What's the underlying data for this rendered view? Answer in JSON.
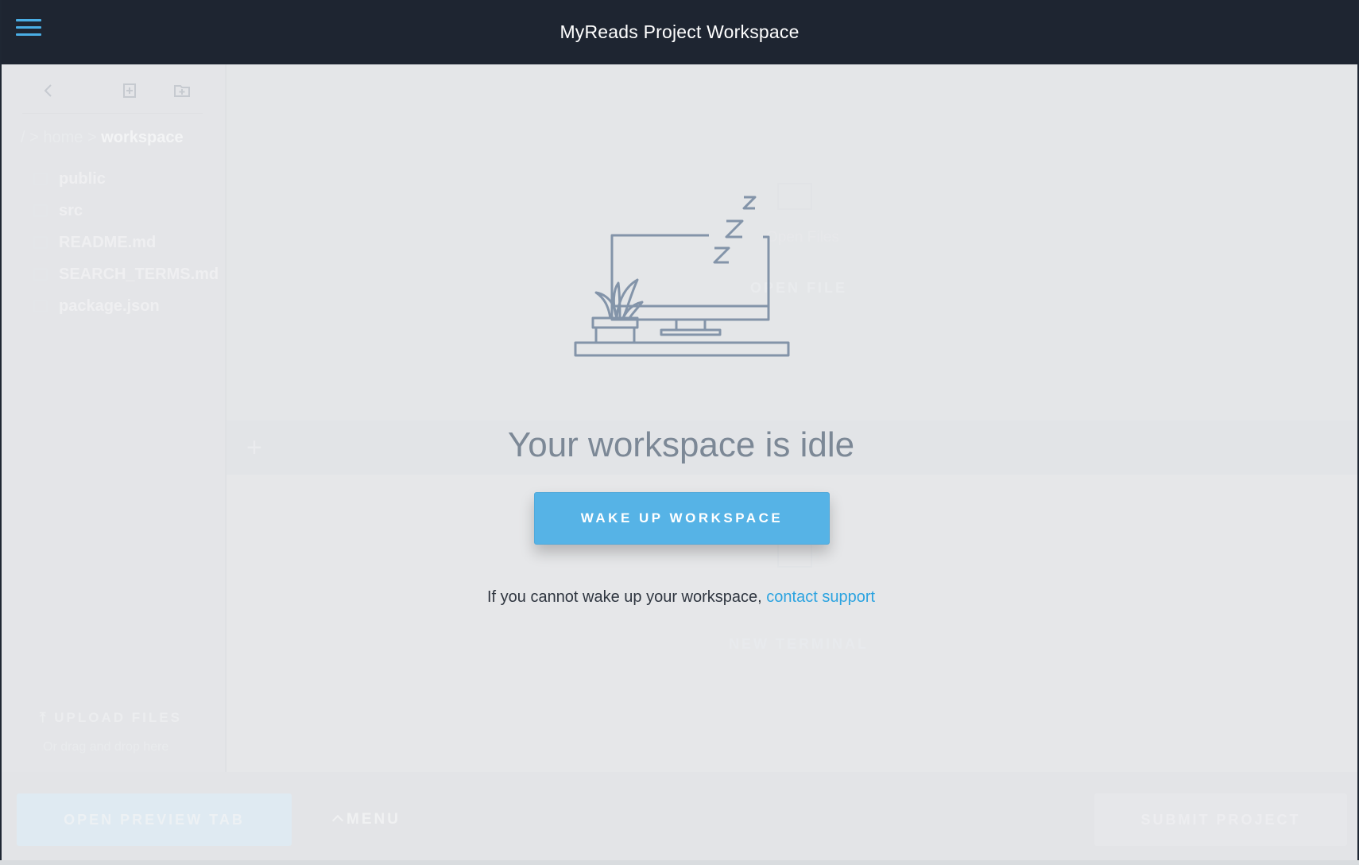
{
  "header": {
    "title": "MyReads Project Workspace",
    "menu_icon": "hamburger-icon"
  },
  "sidebar": {
    "tools": {
      "back_icon": "chevron-left-icon",
      "new_file_icon": "new-file-icon",
      "new_folder_icon": "new-folder-icon"
    },
    "breadcrumb": {
      "root": "/ > ",
      "parent": "home > ",
      "current": "workspace"
    },
    "files": [
      {
        "name": "public",
        "type": "folder"
      },
      {
        "name": "src",
        "type": "folder"
      },
      {
        "name": "README.md",
        "type": "file"
      },
      {
        "name": "SEARCH_TERMS.md",
        "type": "file"
      },
      {
        "name": "package.json",
        "type": "file"
      }
    ],
    "upload_label": "UPLOAD FILES",
    "drag_hint": "Or drag and drop here"
  },
  "editor": {
    "open_files_label": "Open Files",
    "open_file_button": "OPEN FILE"
  },
  "terminal": {
    "add_icon": "plus-icon",
    "new_terminal_button": "NEW TERMINAL"
  },
  "footer": {
    "preview_button": "OPEN PREVIEW TAB",
    "menu_button": "MENU",
    "submit_button": "SUBMIT PROJECT"
  },
  "idle": {
    "title": "Your workspace is idle",
    "wake_button": "WAKE UP WORKSPACE",
    "support_text": "If you cannot wake up your workspace, ",
    "support_link": "contact support",
    "illustration": "sleeping-computer-icon"
  },
  "colors": {
    "accent": "#56b3e6",
    "header_bg": "#1e2531",
    "link": "#2ba3e0"
  }
}
